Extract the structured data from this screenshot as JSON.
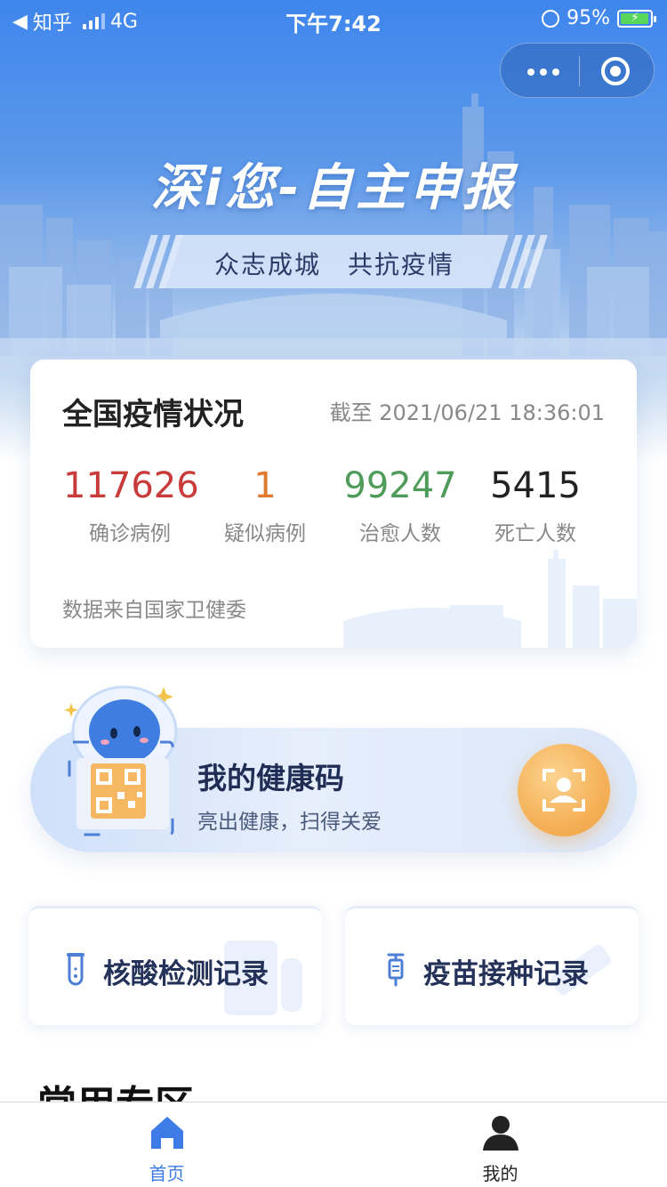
{
  "status_bar": {
    "back_app": "知乎",
    "network": "4G",
    "time": "下午7:42",
    "battery_percent": "95%"
  },
  "hero": {
    "title": "深i您-自主申报",
    "slogan": "众志成城　共抗疫情"
  },
  "stats": {
    "title": "全国疫情状况",
    "as_of": "截至 2021/06/21 18:36:01",
    "items": [
      {
        "value": "117626",
        "label": "确诊病例",
        "color": "#c93a3a"
      },
      {
        "value": "1",
        "label": "疑似病例",
        "color": "#e07a2e"
      },
      {
        "value": "99247",
        "label": "治愈人数",
        "color": "#4f9c5a"
      },
      {
        "value": "5415",
        "label": "死亡人数",
        "color": "#222222"
      }
    ],
    "source": "数据来自国家卫健委"
  },
  "health_code": {
    "title": "我的健康码",
    "subtitle": "亮出健康，扫得关爱"
  },
  "records": [
    {
      "label": "核酸检测记录",
      "icon": "test-tube-icon"
    },
    {
      "label": "疫苗接种记录",
      "icon": "syringe-icon"
    }
  ],
  "section": {
    "title": "常用专区"
  },
  "tab_bar": {
    "items": [
      {
        "label": "首页",
        "icon": "home-icon",
        "active": true,
        "color": "#3d7be6"
      },
      {
        "label": "我的",
        "icon": "user-icon",
        "active": false,
        "color": "#222222"
      }
    ]
  }
}
